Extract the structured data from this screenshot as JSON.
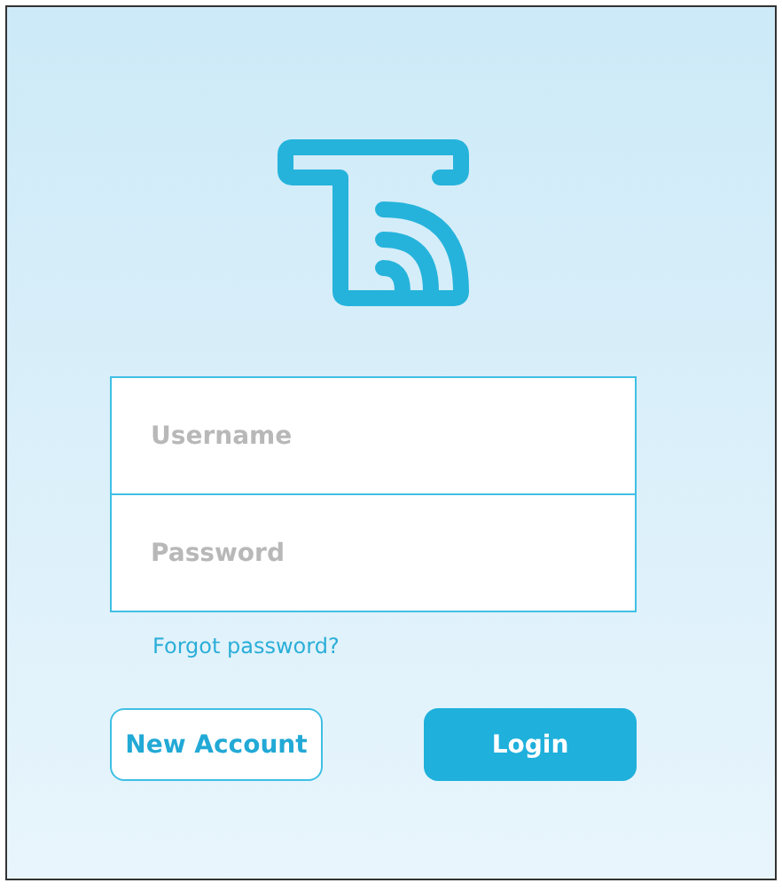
{
  "login": {
    "username": {
      "placeholder": "Username"
    },
    "password": {
      "placeholder": "Password"
    },
    "forgot_link": "Forgot password?",
    "buttons": [
      {
        "label": "New Account",
        "kind": "secondary"
      },
      {
        "label": "Login",
        "kind": "primary"
      }
    ]
  }
}
